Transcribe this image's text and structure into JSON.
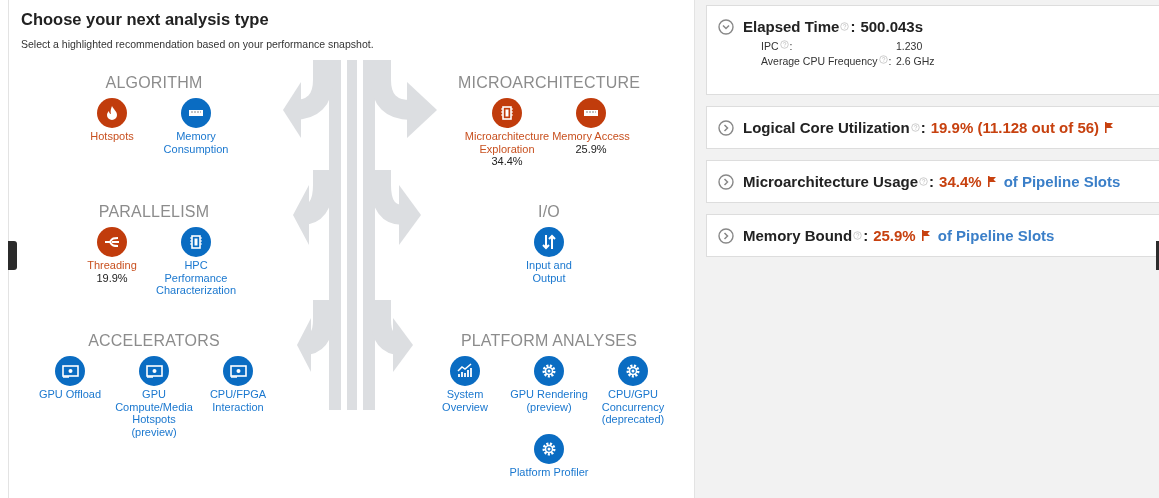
{
  "header": {
    "title": "Choose your next analysis type",
    "subtitle": "Select a highlighted recommendation based on your performance snapshot."
  },
  "groups": [
    {
      "title": "ALGORITHM",
      "tools": [
        {
          "label": "Hotspots",
          "kind": "flame",
          "highlighted": true
        },
        {
          "label": "Memory Consumption",
          "kind": "memory",
          "highlighted": false
        }
      ]
    },
    {
      "title": "MICROARCHITECTURE",
      "tools": [
        {
          "label": "Microarchitecture Exploration",
          "value": "34.4%",
          "kind": "chip",
          "highlighted": true
        },
        {
          "label": "Memory Access",
          "value": "25.9%",
          "kind": "memory",
          "highlighted": true
        }
      ]
    },
    {
      "title": "PARALLELISM",
      "tools": [
        {
          "label": "Threading",
          "value": "19.9%",
          "kind": "threads",
          "highlighted": true
        },
        {
          "label": "HPC Performance Characterization",
          "kind": "chip",
          "highlighted": false
        }
      ]
    },
    {
      "title": "I/O",
      "tools": [
        {
          "label": "Input and Output",
          "kind": "io",
          "highlighted": false
        }
      ]
    },
    {
      "title": "ACCELERATORS",
      "tools": [
        {
          "label": "GPU Offload",
          "kind": "card",
          "highlighted": false
        },
        {
          "label": "GPU Compute/Media Hotspots (preview)",
          "kind": "card",
          "highlighted": false
        },
        {
          "label": "CPU/FPGA Interaction",
          "kind": "card",
          "highlighted": false
        }
      ]
    },
    {
      "title": "PLATFORM ANALYSES",
      "tools": [
        {
          "label": "System Overview",
          "kind": "chart",
          "highlighted": false
        },
        {
          "label": "GPU Rendering (preview)",
          "kind": "gear",
          "highlighted": false
        },
        {
          "label": "CPU/GPU Concurrency (deprecated)",
          "kind": "gear",
          "highlighted": false
        },
        {
          "label": "Platform Profiler",
          "kind": "gear",
          "highlighted": false
        }
      ]
    }
  ],
  "summary": [
    {
      "title": "Elapsed Time",
      "separator": ":",
      "value": "500.043s",
      "flagged": false,
      "expanded": true,
      "metrics": [
        {
          "label": "IPC",
          "separator": ":",
          "value": "1.230"
        },
        {
          "label": "Average CPU Frequency",
          "separator": ":",
          "value": "2.6 GHz"
        }
      ]
    },
    {
      "title": "Logical Core Utilization",
      "separator": ":",
      "value": "19.9% (11.128 out of 56)",
      "flagged": true,
      "expanded": false
    },
    {
      "title": "Microarchitecture Usage",
      "separator": ":",
      "value": "34.4%",
      "flagged": true,
      "suffix": "of Pipeline Slots",
      "expanded": false
    },
    {
      "title": "Memory Bound",
      "separator": ":",
      "value": "25.9%",
      "flagged": true,
      "suffix": "of Pipeline Slots",
      "expanded": false
    }
  ]
}
